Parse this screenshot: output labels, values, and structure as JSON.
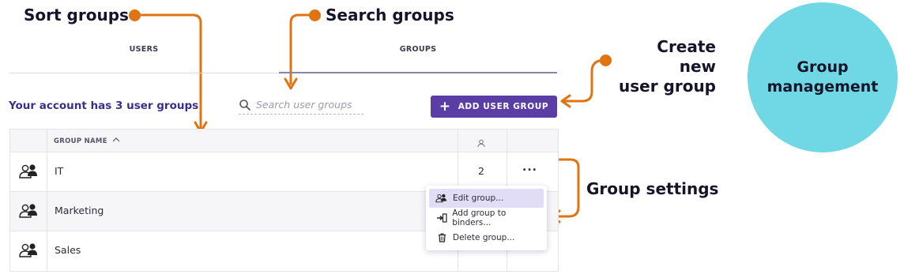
{
  "callouts": {
    "sort": "Sort groups",
    "search": "Search groups",
    "create_line1": "Create new",
    "create_line2": "user group",
    "settings": "Group settings"
  },
  "badge": {
    "line1": "Group",
    "line2": "management"
  },
  "tabs": [
    {
      "label": "USERS",
      "active": false
    },
    {
      "label": "GROUPS",
      "active": true
    }
  ],
  "account_text": "Your account has 3 user groups",
  "search": {
    "placeholder": "Search user groups"
  },
  "add_button": {
    "icon": "+",
    "label": "ADD USER GROUP"
  },
  "table": {
    "columns": {
      "name": "GROUP NAME",
      "sort_indicator": "^",
      "count_icon": "person-icon"
    },
    "rows": [
      {
        "name": "IT",
        "count": "2",
        "actions": "..."
      },
      {
        "name": "Marketing",
        "count": "",
        "actions": ""
      },
      {
        "name": "Sales",
        "count": "",
        "actions": ""
      }
    ]
  },
  "context_menu": {
    "items": [
      {
        "label": "Edit group...",
        "icon": "group-icon",
        "selected": true
      },
      {
        "label": "Add group to binders...",
        "icon": "add-to-binder-icon",
        "selected": false
      },
      {
        "label": "Delete group...",
        "icon": "trash-icon",
        "selected": false
      }
    ]
  },
  "colors": {
    "accent": "#5b3ea5",
    "callout_orange": "#e07412",
    "badge": "#6fd8e4",
    "account_text": "#3c2e8c",
    "menu_selected": "#e2ddf6"
  }
}
